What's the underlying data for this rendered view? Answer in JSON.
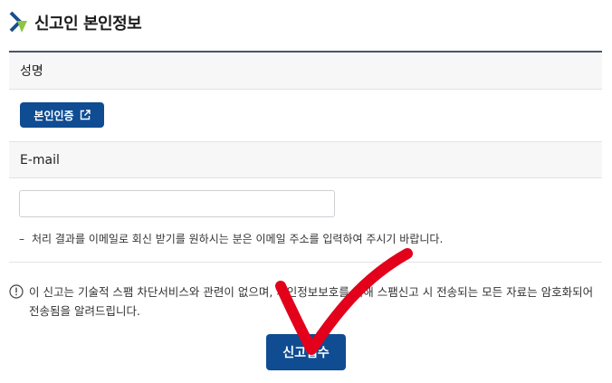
{
  "section": {
    "title": "신고인 본인정보",
    "icon": "brand-chevron-icon",
    "icon_colors": [
      "#1a4f8f",
      "#8dc63f"
    ]
  },
  "form": {
    "name_label": "성명",
    "verify_button_label": "본인인증",
    "verify_button_icon": "external-link-icon",
    "email_label": "E-mail",
    "email_value": "",
    "email_placeholder": "",
    "help_dash": "–",
    "help_text": "처리 결과를 이메일로 회신 받기를 원하시는 분은 이메일 주소를 입력하여 주시기 바랍니다."
  },
  "notice": {
    "icon": "info-circle-icon",
    "text": "이 신고는 기술적 스팸 차단서비스와 관련이 없으며, 개인정보보호를 위해 스팸신고 시 전송되는 모든 자료는 암호화되어 전송됨을 알려드립니다."
  },
  "submit_button_label": "신고접수",
  "colors": {
    "primary": "#0f4c92",
    "annotation_red": "#e3001b",
    "header_bg": "#f7f7f8"
  }
}
